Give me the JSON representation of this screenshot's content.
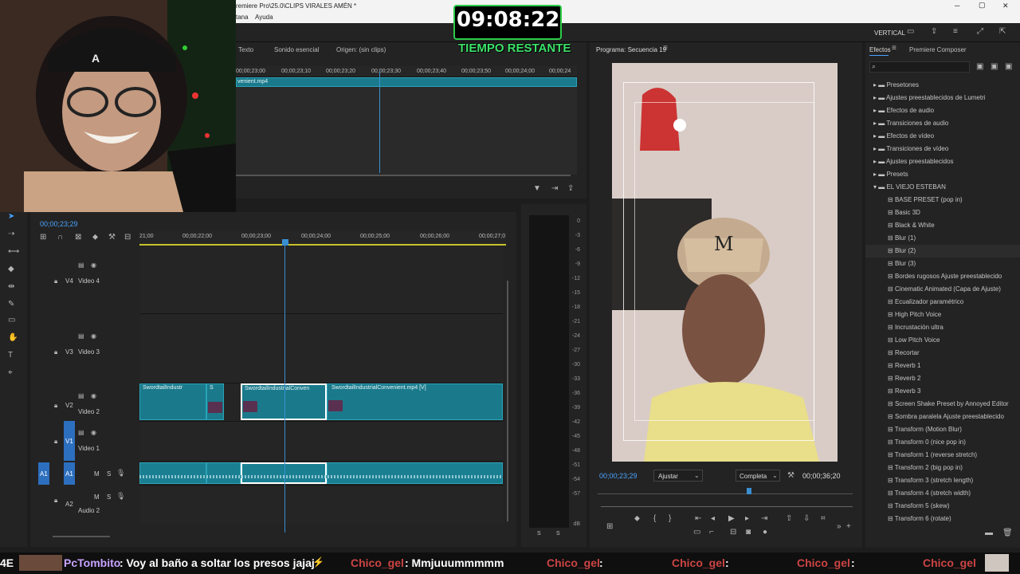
{
  "titlebar": {
    "title": "remiere Pro\\25.0\\CLIPS VIRALES AMÉN *",
    "minimize": "─",
    "maximize": "▢",
    "close": "✕"
  },
  "menubar": {
    "items": [
      "tana",
      "Ayuda"
    ]
  },
  "workspace": {
    "label": "VERTICAL"
  },
  "timer": {
    "time": "09:08:22",
    "label": "TIEMPO RESTANTE"
  },
  "source_panel": {
    "tabs": [
      "Texto",
      "Sonido esencial",
      "Origen: (sin clips)"
    ],
    "ruler": [
      "00;00;23;00",
      "00;00;23;10",
      "00;00;23;20",
      "00;00;23;30",
      "00;00;23;40",
      "00;00;23;50",
      "00;00;24;00",
      "00;00;24"
    ],
    "clip_name": "venient.mp4"
  },
  "program": {
    "title": "Programa: Secuencia 19",
    "timecode": "00;00;23;29",
    "fit": "Ajustar",
    "quality": "Completa",
    "duration": "00;00;36;20"
  },
  "timeline": {
    "timecode": "00;00;23;29",
    "ruler": [
      "21;00",
      "00;00;22;00",
      "00;00;23;00",
      "00;00;24;00",
      "00;00;25;00",
      "00;00;26;00",
      "00;00;27;0"
    ],
    "tracks": [
      {
        "id": "V4",
        "name": "Video 4"
      },
      {
        "id": "V3",
        "name": "Video 3"
      },
      {
        "id": "V2",
        "name": "Video 2"
      },
      {
        "id": "V1",
        "name": "Video 1"
      },
      {
        "id": "A1",
        "name": ""
      },
      {
        "id": "A2",
        "name": "Audio 2"
      }
    ],
    "src_a1": "A1",
    "clips": [
      "SwordtailIndustr",
      "S",
      "SwordtailIndustrialConven",
      "SwordtailIndustrialConvenient.mp4 [V]"
    ],
    "track_letters": {
      "mute": "M",
      "solo": "S"
    }
  },
  "meter": {
    "scale": [
      "0",
      "-3",
      "-6",
      "-9",
      "-12",
      "-15",
      "-18",
      "-21",
      "-24",
      "-27",
      "-30",
      "-33",
      "-36",
      "-39",
      "-42",
      "-45",
      "-48",
      "-51",
      "-54",
      "-57",
      "dB"
    ],
    "ss": [
      "S",
      "S"
    ]
  },
  "effects": {
    "tabs": [
      "Efectos",
      "Premiere Composer"
    ],
    "folders": [
      "Presetones",
      "Ajustes preestablecidos de Lumetri",
      "Efectos de audio",
      "Transiciones de audio",
      "Efectos de vídeo",
      "Transiciones de vídeo",
      "Ajustes preestablecidos",
      "Presets",
      "EL VIEJO ESTEBAN"
    ],
    "items": [
      "BASE PRESET (pop in)",
      "Basic 3D",
      "Black & White",
      "Blur (1)",
      "Blur (2)",
      "Blur (3)",
      "Bordes rugosos Ajuste preestablecido",
      "Cinematic Animated (Capa de Ajuste)",
      "Ecualizador paramétrico",
      "High Pitch Voice",
      "Incrustación ultra",
      "Low Pitch Voice",
      "Recortar",
      "Reverb 1",
      "Reverb 2",
      "Reverb 3",
      "Screen Shake Preset by Annoyed Editor",
      "Sombra paralela Ajuste preestablecido",
      "Transform (Motion Blur)",
      "Transform 0 (nice pop in)",
      "Transform 1 (reverse stretch)",
      "Transform 2 (big pop in)",
      "Transform 3 (stretch length)",
      "Transform 4 (stretch width)",
      "Transform 5 (skew)",
      "Transform 6 (rotate)"
    ],
    "selected": "Blur (2)"
  },
  "chat": {
    "prefix": "4E",
    "user1": "PcTombito",
    "msg1": ": Voy al baño a soltar los presos jajaj",
    "user2": "Chico_gel",
    "msg2": ": Mmjuuummmmm",
    "user3": "Chico_gel",
    "user4": "Chico_gel",
    "user5": "Chico_gel",
    "user6": "Chico_gel",
    "colon": ":"
  },
  "colors": {
    "accent_blue": "#2d8ceb",
    "clip": "#1a7a8c",
    "playhead": "#3a8fd1",
    "chat_red": "#cc3b3b"
  }
}
